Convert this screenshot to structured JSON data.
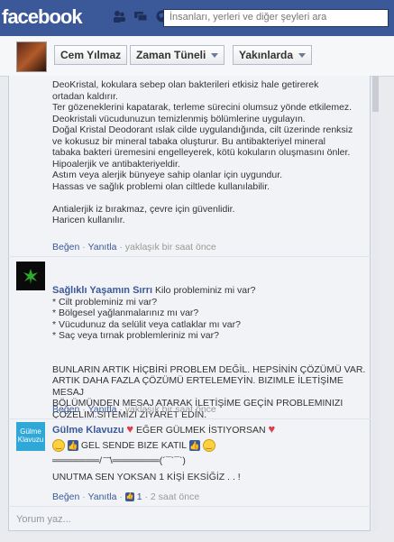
{
  "topbar": {
    "logo": "facebook",
    "search_placeholder": "İnsanları, yerleri ve diğer şeyleri ara"
  },
  "profile_bar": {
    "name": "Cem Yılmaz",
    "timeline": "Zaman Tüneli",
    "friends": "Yakınlarda"
  },
  "comments": [
    {
      "lines": [
        "DeoKristal, kokulara sebep olan bakterileri etkisiz hale getirerek",
        "ortadan kaldırır.",
        "Ter gözeneklerini kapatarak, terleme sürecini olumsuz yönde etkilemez.",
        "Deokristali vücudunuzun temizlenmiş bölümlerine uygulayın.",
        "Doğal Kristal Deodorant ıslak cilde uygulandığında, cilt üzerinde renksiz",
        "ve kokusuz bir mineral tabaka oluşturur. Bu antibakteriyel mineral",
        "tabaka bakteri üremesini engelleyerek, kötü kokuların oluşmasını önler.",
        "Hipoalerjik ve antibakteriyeldir.",
        "Astım veya alerjik bünyeye sahip olanlar için uygundur.",
        "Hassas ve sağlık problemi olan ciltlede kullanılabilir.",
        "",
        "Antialerjik iz bırakmaz, çevre için güvenlidir.",
        "Haricen kullanılır."
      ],
      "like": "Beğen",
      "reply": "Yanıtla",
      "time": "yaklaşık bir saat önce"
    },
    {
      "author": "Sağlıklı Yaşamın Sırrı",
      "first": "Kilo probleminiz mi var?",
      "lines": [
        "* Cilt probleminiz mi var?",
        "* Bölgesel yağlanmalarınız mı var?",
        "* Vücudunuz da selülit veya catlaklar mı var?",
        "* Saç veya tırnak problemleriniz mi var?",
        "",
        "",
        "BUNLARIN ARTIK HİÇBİRİ PROBLEM DEĞİL. HEPSİNİN ÇÖZÜMÜ VAR.",
        "ARTIK DAHA FAZLA ÇÖZÜMÜ ERTELEMEYİN. BIZIMLE İLETİŞİME",
        "MESAJ",
        "BÖLÜMÜNDEN MESAJ ATARAK İLETİŞİME GEÇİN PROBLEMINIZI",
        "ÇÖZELIM.SITEMIZI ZİYARET EDİN."
      ],
      "like": "Beğen",
      "reply": "Yanıtla",
      "time": "yaklaşık bir saat önce"
    },
    {
      "author": "Gülme Klavuzu",
      "avatar_text": "Gülme Klavuzu",
      "first": "EĞER GÜLMEK İSTIYORSAN",
      "line2": "GEL SENDE BIZE KATIL",
      "ascii": "═══════/ ̄ ̄ ̄\\═══════(´¯`¯`)",
      "line4": "UNUTMA SEN YOKSAN 1 KİŞİ EKSİĞİZ . . !",
      "like": "Beğen",
      "reply": "Yanıtla",
      "likes": "1",
      "time": "2 saat önce"
    }
  ],
  "write_comment": "Yorum yaz...",
  "icons": [
    "friends-icon",
    "messages-icon",
    "globe-icon",
    "heart-icon",
    "smile-icon",
    "thumbs-up-icon"
  ],
  "colors": {
    "brand": "#3b5998",
    "link": "#3b5998",
    "meta": "#999999"
  }
}
